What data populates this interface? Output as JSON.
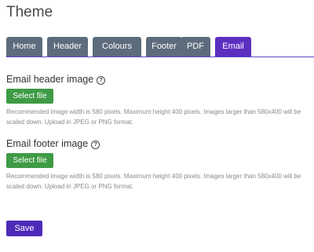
{
  "page": {
    "title": "Theme"
  },
  "tabs": [
    {
      "label": "Home",
      "active": false
    },
    {
      "label": "Header",
      "active": false
    },
    {
      "label": "Colours",
      "active": false
    },
    {
      "label": "Footer",
      "active": false
    },
    {
      "label": "PDF",
      "active": false
    },
    {
      "label": "Email",
      "active": true
    }
  ],
  "email_header": {
    "label": "Email header image",
    "help_icon": "question-circle-icon",
    "button_label": "Select file",
    "hint": "Recommended image width is 580 pixels. Maximum height 400 pixels. Images larger than 580x400 will be scaled down. Upload in JPEG or PNG format."
  },
  "email_footer": {
    "label": "Email footer image",
    "help_icon": "question-circle-icon",
    "button_label": "Select file",
    "hint": "Recommended image width is 580 pixels. Maximum height 400 pixels. Images larger than 580x400 will be scaled down. Upload in JPEG or PNG format."
  },
  "actions": {
    "save_label": "Save"
  },
  "colors": {
    "tab_inactive": "#5d6c7c",
    "tab_active": "#5b2fc0",
    "file_button": "#3f9b45",
    "save_button": "#4f2ab8"
  }
}
